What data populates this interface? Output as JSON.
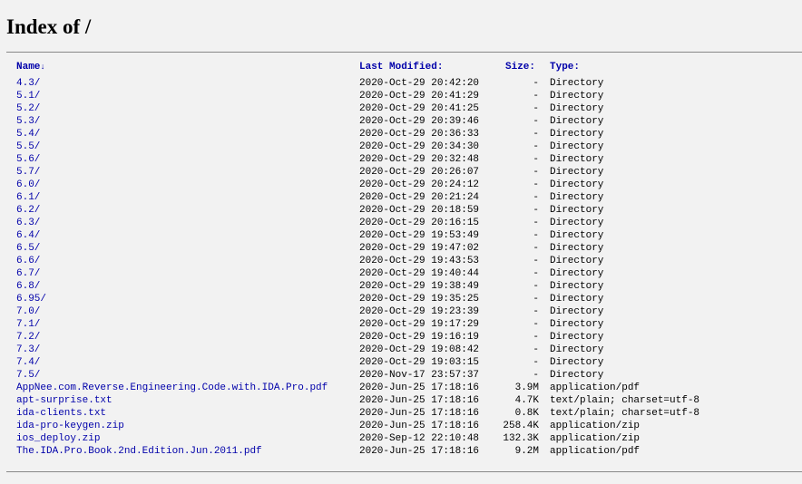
{
  "page": {
    "title": "Index of /"
  },
  "columns": {
    "name": "Name",
    "sort_arrow": "↓",
    "last_modified": "Last Modified:",
    "size": "Size:",
    "type": "Type:"
  },
  "entries": [
    {
      "name": "4.3/",
      "modified": "2020-Oct-29 20:42:20",
      "size": "-",
      "type": "Directory"
    },
    {
      "name": "5.1/",
      "modified": "2020-Oct-29 20:41:29",
      "size": "-",
      "type": "Directory"
    },
    {
      "name": "5.2/",
      "modified": "2020-Oct-29 20:41:25",
      "size": "-",
      "type": "Directory"
    },
    {
      "name": "5.3/",
      "modified": "2020-Oct-29 20:39:46",
      "size": "-",
      "type": "Directory"
    },
    {
      "name": "5.4/",
      "modified": "2020-Oct-29 20:36:33",
      "size": "-",
      "type": "Directory"
    },
    {
      "name": "5.5/",
      "modified": "2020-Oct-29 20:34:30",
      "size": "-",
      "type": "Directory"
    },
    {
      "name": "5.6/",
      "modified": "2020-Oct-29 20:32:48",
      "size": "-",
      "type": "Directory"
    },
    {
      "name": "5.7/",
      "modified": "2020-Oct-29 20:26:07",
      "size": "-",
      "type": "Directory"
    },
    {
      "name": "6.0/",
      "modified": "2020-Oct-29 20:24:12",
      "size": "-",
      "type": "Directory"
    },
    {
      "name": "6.1/",
      "modified": "2020-Oct-29 20:21:24",
      "size": "-",
      "type": "Directory"
    },
    {
      "name": "6.2/",
      "modified": "2020-Oct-29 20:18:59",
      "size": "-",
      "type": "Directory"
    },
    {
      "name": "6.3/",
      "modified": "2020-Oct-29 20:16:15",
      "size": "-",
      "type": "Directory"
    },
    {
      "name": "6.4/",
      "modified": "2020-Oct-29 19:53:49",
      "size": "-",
      "type": "Directory"
    },
    {
      "name": "6.5/",
      "modified": "2020-Oct-29 19:47:02",
      "size": "-",
      "type": "Directory"
    },
    {
      "name": "6.6/",
      "modified": "2020-Oct-29 19:43:53",
      "size": "-",
      "type": "Directory"
    },
    {
      "name": "6.7/",
      "modified": "2020-Oct-29 19:40:44",
      "size": "-",
      "type": "Directory"
    },
    {
      "name": "6.8/",
      "modified": "2020-Oct-29 19:38:49",
      "size": "-",
      "type": "Directory"
    },
    {
      "name": "6.95/",
      "modified": "2020-Oct-29 19:35:25",
      "size": "-",
      "type": "Directory"
    },
    {
      "name": "7.0/",
      "modified": "2020-Oct-29 19:23:39",
      "size": "-",
      "type": "Directory"
    },
    {
      "name": "7.1/",
      "modified": "2020-Oct-29 19:17:29",
      "size": "-",
      "type": "Directory"
    },
    {
      "name": "7.2/",
      "modified": "2020-Oct-29 19:16:19",
      "size": "-",
      "type": "Directory"
    },
    {
      "name": "7.3/",
      "modified": "2020-Oct-29 19:08:42",
      "size": "-",
      "type": "Directory"
    },
    {
      "name": "7.4/",
      "modified": "2020-Oct-29 19:03:15",
      "size": "-",
      "type": "Directory"
    },
    {
      "name": "7.5/",
      "modified": "2020-Nov-17 23:57:37",
      "size": "-",
      "type": "Directory"
    },
    {
      "name": "AppNee.com.Reverse.Engineering.Code.with.IDA.Pro.pdf",
      "modified": "2020-Jun-25 17:18:16",
      "size": "3.9M",
      "type": "application/pdf"
    },
    {
      "name": "apt-surprise.txt",
      "modified": "2020-Jun-25 17:18:16",
      "size": "4.7K",
      "type": "text/plain; charset=utf-8"
    },
    {
      "name": "ida-clients.txt",
      "modified": "2020-Jun-25 17:18:16",
      "size": "0.8K",
      "type": "text/plain; charset=utf-8"
    },
    {
      "name": "ida-pro-keygen.zip",
      "modified": "2020-Jun-25 17:18:16",
      "size": "258.4K",
      "type": "application/zip"
    },
    {
      "name": "ios_deploy.zip",
      "modified": "2020-Sep-12 22:10:48",
      "size": "132.3K",
      "type": "application/zip"
    },
    {
      "name": "The.IDA.Pro.Book.2nd.Edition.Jun.2011.pdf",
      "modified": "2020-Jun-25 17:18:16",
      "size": "9.2M",
      "type": "application/pdf"
    }
  ]
}
